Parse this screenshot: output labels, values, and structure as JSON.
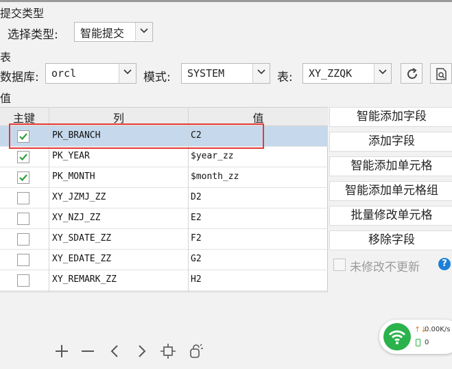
{
  "submit_type": {
    "section_label": "提交类型",
    "select_label": "选择类型:",
    "selected": "智能提交"
  },
  "table_section": {
    "section_label": "表",
    "db_label": "数据库:",
    "db_value": "orcl",
    "schema_label": "模式:",
    "schema_value": "SYSTEM",
    "table_label": "表:",
    "table_value": "XY_ZZQK"
  },
  "value_section": {
    "section_label": "值",
    "columns": {
      "key": "主键",
      "column": "列",
      "value": "值"
    },
    "rows": [
      {
        "key": true,
        "column": "PK_BRANCH",
        "value": "C2"
      },
      {
        "key": true,
        "column": "PK_YEAR",
        "value": "$year_zz"
      },
      {
        "key": true,
        "column": "PK_MONTH",
        "value": "$month_zz"
      },
      {
        "key": false,
        "column": "XY_JZMJ_ZZ",
        "value": "D2"
      },
      {
        "key": false,
        "column": "XY_NZJ_ZZ",
        "value": "E2"
      },
      {
        "key": false,
        "column": "XY_SDATE_ZZ",
        "value": "F2"
      },
      {
        "key": false,
        "column": "XY_EDATE_ZZ",
        "value": "G2"
      },
      {
        "key": false,
        "column": "XY_REMARK_ZZ",
        "value": "H2"
      }
    ]
  },
  "side_buttons": {
    "smart_add_field": "智能添加字段",
    "add_field": "添加字段",
    "smart_add_cell": "智能添加单元格",
    "smart_add_cell_group": "智能添加单元格组",
    "batch_edit_cell": "批量修改单元格",
    "remove_field": "移除字段",
    "no_update_label": "未修改不更新"
  },
  "network": {
    "speed": "0.00K/s",
    "count": "0"
  },
  "colors": {
    "selected_row": "#c6d9ec",
    "check_green": "#2e9e3a",
    "highlight": "#e53935",
    "help_blue": "#1e7fd8",
    "wifi_green": "#2bb24c"
  }
}
